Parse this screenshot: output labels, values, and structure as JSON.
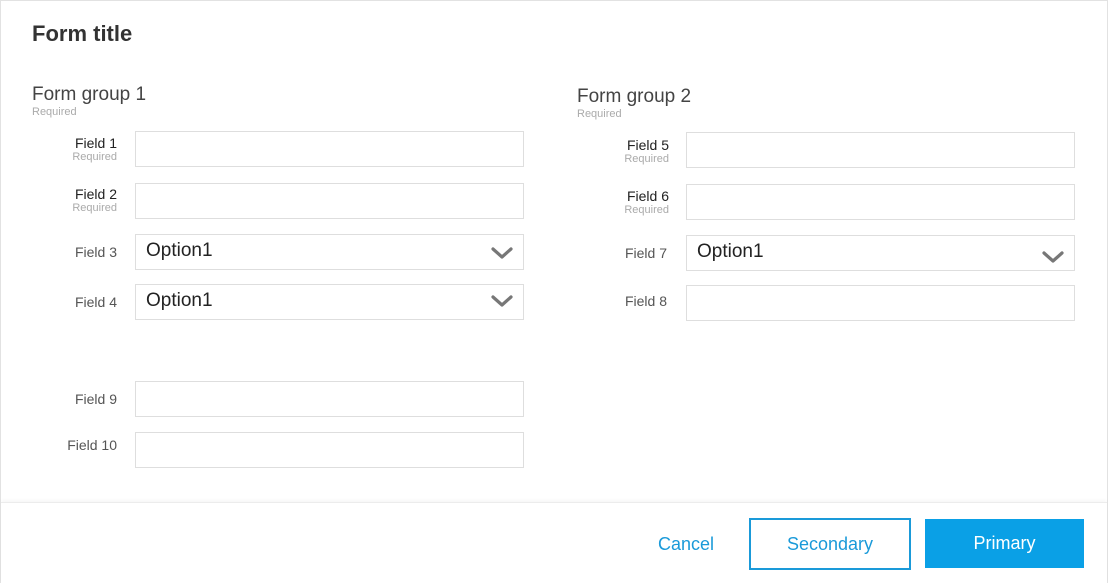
{
  "form": {
    "title": "Form title"
  },
  "group1": {
    "title": "Form group 1",
    "required": "Required",
    "fields": [
      {
        "label": "Field 1",
        "sub": "Required",
        "type": "text",
        "value": ""
      },
      {
        "label": "Field 2",
        "sub": "Required",
        "type": "text",
        "value": ""
      },
      {
        "label": "Field 3",
        "type": "select",
        "value": "Option1"
      },
      {
        "label": "Field 4",
        "type": "select",
        "value": "Option1"
      },
      {
        "label": "Field 9",
        "type": "text",
        "value": ""
      },
      {
        "label": "Field 10",
        "type": "text",
        "value": ""
      }
    ]
  },
  "group2": {
    "title": "Form group 2",
    "required": "Required",
    "fields": [
      {
        "label": "Field 5",
        "sub": "Required",
        "type": "text",
        "value": ""
      },
      {
        "label": "Field 6",
        "sub": "Required",
        "type": "text",
        "value": ""
      },
      {
        "label": "Field 7",
        "type": "select",
        "value": "Option1"
      },
      {
        "label": "Field 8",
        "type": "text",
        "value": ""
      }
    ]
  },
  "footer": {
    "cancel_label": "Cancel",
    "secondary_label": "Secondary",
    "primary_label": "Primary"
  },
  "colors": {
    "accent": "#1a9ad9",
    "primary_bg": "#0aa0e6",
    "chevron": "#777777"
  },
  "icons": {
    "select": "chevron-down-icon"
  }
}
